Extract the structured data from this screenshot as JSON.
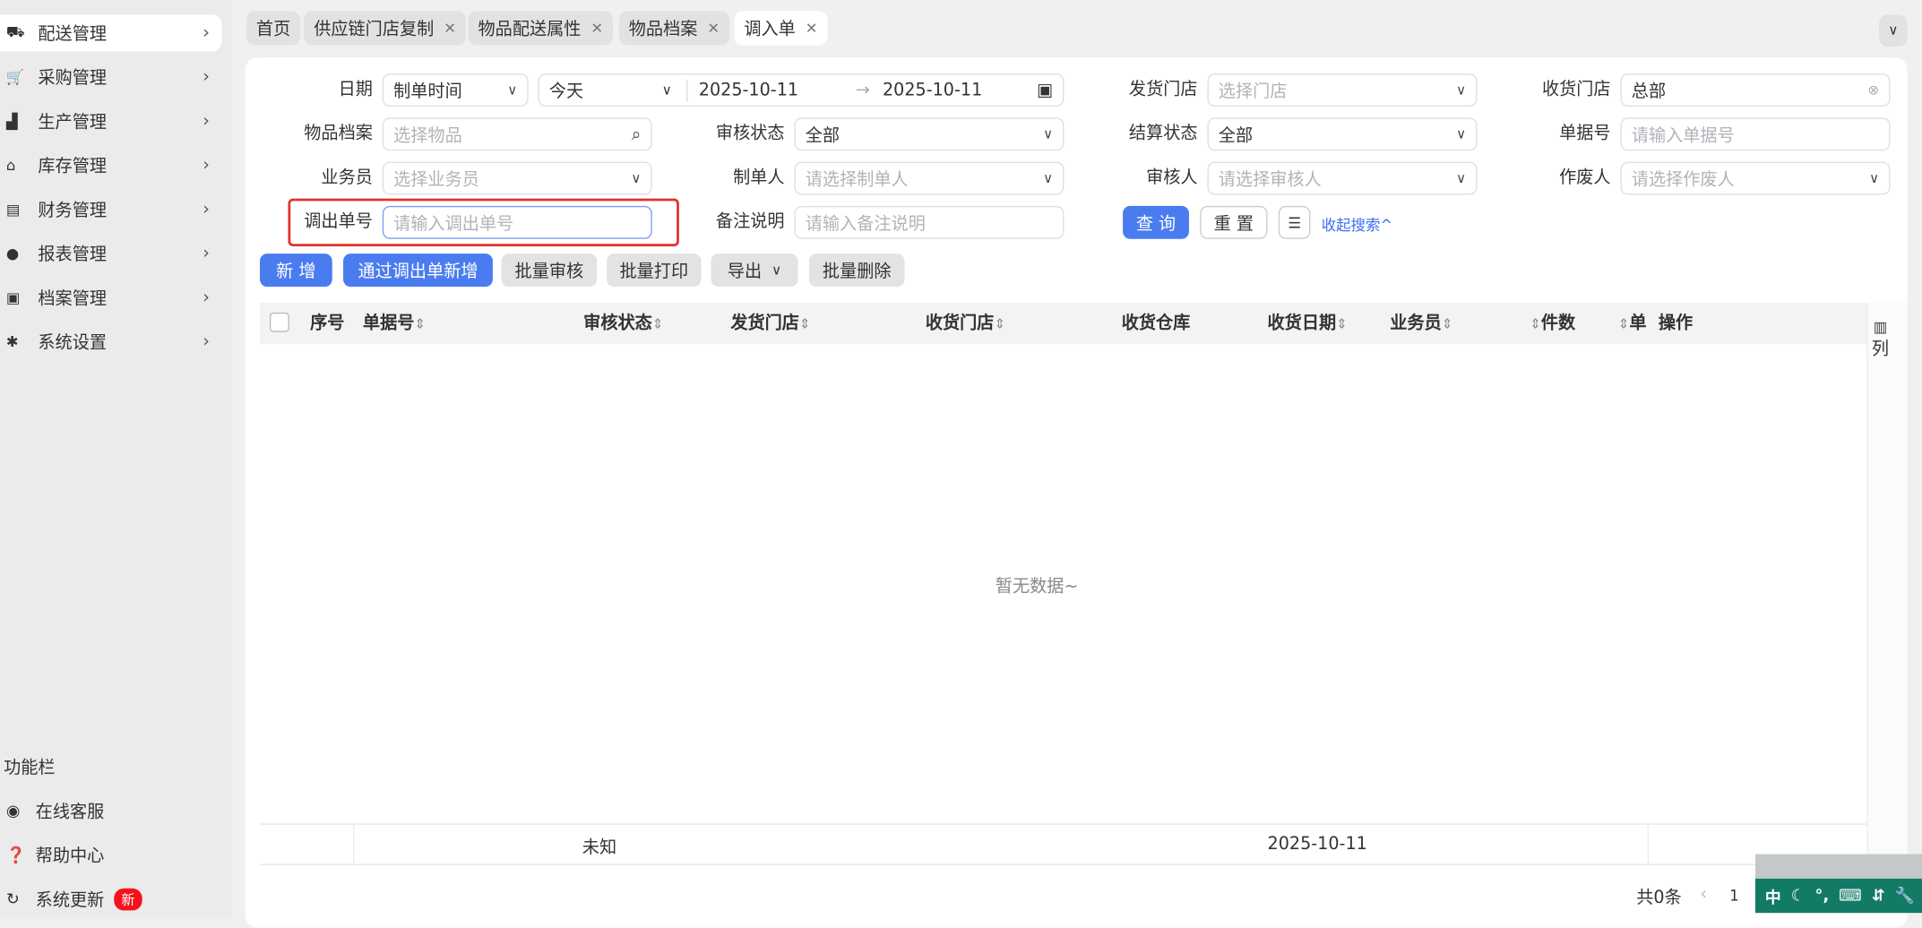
{
  "sidebar": {
    "items": [
      {
        "label": "配送管理",
        "icon": "truck-icon"
      },
      {
        "label": "采购管理",
        "icon": "cart-icon"
      },
      {
        "label": "生产管理",
        "icon": "factory-icon"
      },
      {
        "label": "库存管理",
        "icon": "warehouse-icon"
      },
      {
        "label": "财务管理",
        "icon": "finance-icon"
      },
      {
        "label": "报表管理",
        "icon": "globe-icon"
      },
      {
        "label": "档案管理",
        "icon": "archive-icon"
      },
      {
        "label": "系统设置",
        "icon": "gear-icon"
      }
    ],
    "function_bar": "功能栏",
    "support": "在线客服",
    "help": "帮助中心",
    "update": "系统更新",
    "update_badge": "新"
  },
  "tabs": [
    {
      "label": "首页"
    },
    {
      "label": "供应链门店复制"
    },
    {
      "label": "物品配送属性"
    },
    {
      "label": "物品档案"
    },
    {
      "label": "调入单"
    }
  ],
  "form": {
    "date_label": "日期",
    "date_type": "制单时间",
    "date_preset": "今天",
    "date_start": "2025-10-11",
    "date_end": "2025-10-11",
    "ship_store_label": "发货门店",
    "ship_store_ph": "选择门店",
    "recv_store_label": "收货门店",
    "recv_store_value": "总部",
    "item_label": "物品档案",
    "item_ph": "选择物品",
    "audit_status_label": "审核状态",
    "audit_status_value": "全部",
    "settle_status_label": "结算状态",
    "settle_status_value": "全部",
    "doc_no_label": "单据号",
    "doc_no_ph": "请输入单据号",
    "salesman_label": "业务员",
    "salesman_ph": "选择业务员",
    "creator_label": "制单人",
    "creator_ph": "请选择制单人",
    "auditor_label": "审核人",
    "auditor_ph": "请选择审核人",
    "voider_label": "作废人",
    "voider_ph": "请选择作废人",
    "out_no_label": "调出单号",
    "out_no_ph": "请输入调出单号",
    "remark_label": "备注说明",
    "remark_ph": "请输入备注说明",
    "query": "查 询",
    "reset": "重 置",
    "collapse": "收起搜索^"
  },
  "actions": {
    "add": "新 增",
    "add_from_out": "通过调出单新增",
    "batch_audit": "批量审核",
    "batch_print": "批量打印",
    "export": "导出",
    "batch_delete": "批量删除"
  },
  "table": {
    "headers": [
      "序号",
      "单据号",
      "审核状态",
      "发货门店",
      "收货门店",
      "收货仓库",
      "收货日期",
      "业务员",
      "件数",
      "单",
      "操作"
    ],
    "columns_btn": "列",
    "empty": "暂无数据~",
    "summary": {
      "audit": "未知",
      "date": "2025-10-11"
    }
  },
  "pagination": {
    "total": "共0条",
    "page": "1"
  },
  "ime": {
    "mode": "中"
  },
  "colors": {
    "primary": "#4a7cf0",
    "highlight": "#e0332a",
    "ime": "#127a65"
  }
}
